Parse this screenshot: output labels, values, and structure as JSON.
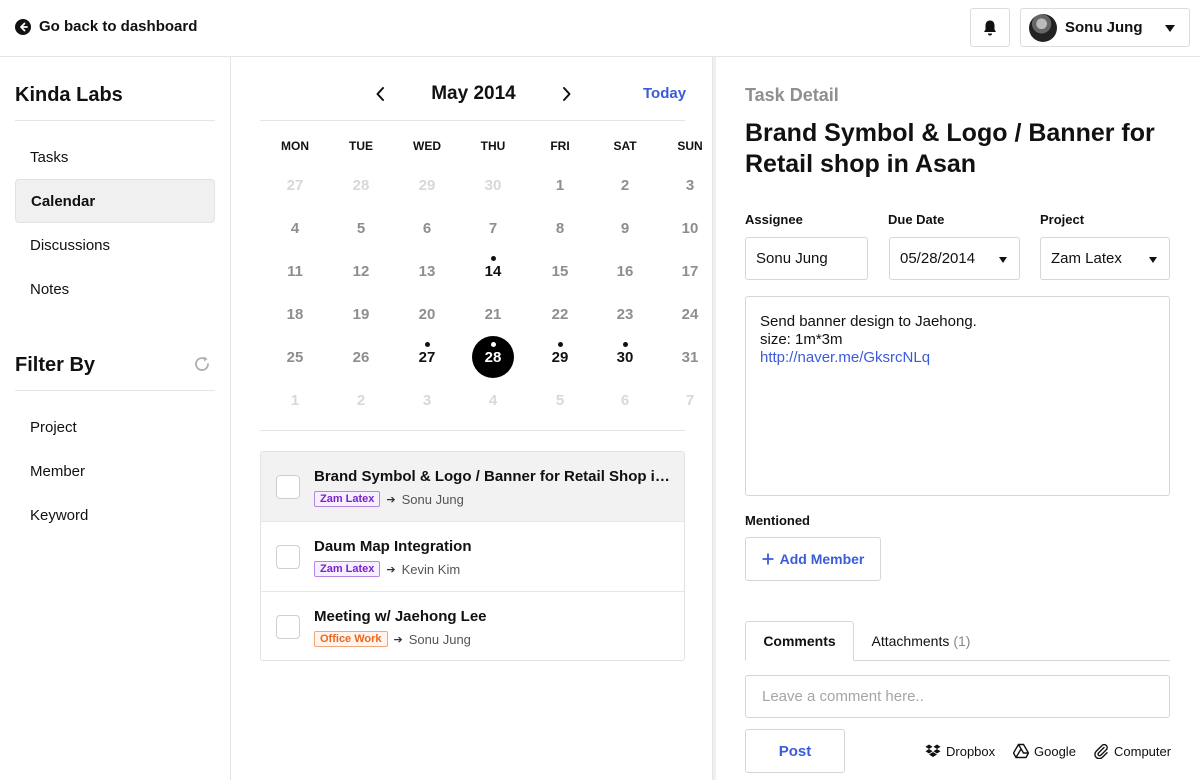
{
  "header": {
    "back_label": "Go back to dashboard",
    "user_name": "Sonu Jung"
  },
  "sidebar": {
    "org_name": "Kinda Labs",
    "nav_items": [
      {
        "label": "Tasks",
        "active": false
      },
      {
        "label": "Calendar",
        "active": true
      },
      {
        "label": "Discussions",
        "active": false
      },
      {
        "label": "Notes",
        "active": false
      }
    ],
    "filter_title": "Filter By",
    "filters": [
      "Project",
      "Member",
      "Keyword"
    ]
  },
  "calendar": {
    "month_title": "May 2014",
    "today_label": "Today",
    "weekdays": [
      "MON",
      "TUE",
      "WED",
      "THU",
      "FRI",
      "SAT",
      "SUN"
    ],
    "weeks": [
      [
        {
          "d": "27",
          "faded": true
        },
        {
          "d": "28",
          "faded": true
        },
        {
          "d": "29",
          "faded": true
        },
        {
          "d": "30",
          "faded": true
        },
        {
          "d": "1"
        },
        {
          "d": "2"
        },
        {
          "d": "3"
        }
      ],
      [
        {
          "d": "4"
        },
        {
          "d": "5"
        },
        {
          "d": "6"
        },
        {
          "d": "7"
        },
        {
          "d": "8"
        },
        {
          "d": "9"
        },
        {
          "d": "10"
        }
      ],
      [
        {
          "d": "11"
        },
        {
          "d": "12"
        },
        {
          "d": "13"
        },
        {
          "d": "14",
          "event": true
        },
        {
          "d": "15"
        },
        {
          "d": "16"
        },
        {
          "d": "17"
        }
      ],
      [
        {
          "d": "18"
        },
        {
          "d": "19"
        },
        {
          "d": "20"
        },
        {
          "d": "21"
        },
        {
          "d": "22"
        },
        {
          "d": "23"
        },
        {
          "d": "24"
        }
      ],
      [
        {
          "d": "25"
        },
        {
          "d": "26"
        },
        {
          "d": "27",
          "event": true
        },
        {
          "d": "28",
          "event": true,
          "selected": true
        },
        {
          "d": "29",
          "event": true
        },
        {
          "d": "30",
          "event": true
        },
        {
          "d": "31"
        }
      ],
      [
        {
          "d": "1",
          "faded": true
        },
        {
          "d": "2",
          "faded": true
        },
        {
          "d": "3",
          "faded": true
        },
        {
          "d": "4",
          "faded": true
        },
        {
          "d": "5",
          "faded": true
        },
        {
          "d": "6",
          "faded": true
        },
        {
          "d": "7",
          "faded": true
        }
      ]
    ]
  },
  "tasks": [
    {
      "title": "Brand Symbol & Logo / Banner for Retail Shop in Asan",
      "tag": "Zam Latex",
      "tag_color": "purple",
      "assignee": "Sonu Jung",
      "active": true
    },
    {
      "title": "Daum Map Integration",
      "tag": "Zam Latex",
      "tag_color": "purple",
      "assignee": "Kevin Kim",
      "active": false
    },
    {
      "title": "Meeting w/ Jaehong Lee",
      "tag": "Office Work",
      "tag_color": "orange",
      "assignee": "Sonu Jung",
      "active": false
    }
  ],
  "detail": {
    "label": "Task Detail",
    "title": "Brand Symbol & Logo / Banner for Retail shop in Asan",
    "assignee_label": "Assignee",
    "assignee_value": "Sonu Jung",
    "due_label": "Due Date",
    "due_value": "05/28/2014",
    "project_label": "Project",
    "project_value": "Zam Latex",
    "description_line1": "Send banner design to Jaehong.",
    "description_line2": "size: 1m*3m",
    "description_link": "http://naver.me/GksrcNLq",
    "mentioned_label": "Mentioned",
    "add_member_label": "Add Member",
    "tab_comments": "Comments",
    "tab_attachments": "Attachments",
    "attachments_count": "(1)",
    "comment_placeholder": "Leave a comment here..",
    "post_label": "Post",
    "attach_sources": [
      "Dropbox",
      "Google",
      "Computer"
    ]
  },
  "colors": {
    "accent": "#3b5bdb",
    "tag_purple": "#7b22c9",
    "tag_orange": "#f0661b"
  }
}
